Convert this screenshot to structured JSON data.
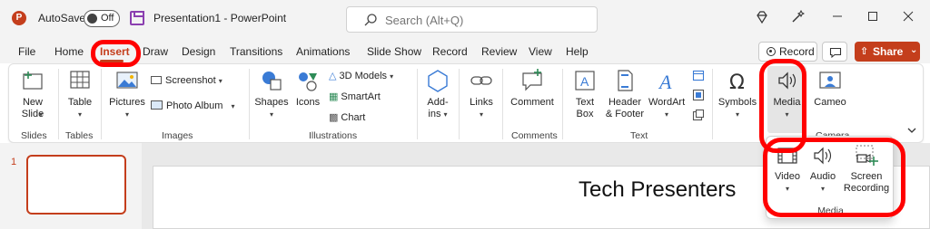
{
  "titlebar": {
    "autosave_label": "AutoSave",
    "autosave_state": "Off",
    "document_title": "Presentation1  -  PowerPoint",
    "search_placeholder": "Search (Alt+Q)",
    "icons": [
      "diamond-icon",
      "wand-icon",
      "minimize-icon",
      "maximize-icon",
      "close-icon"
    ]
  },
  "tabs": [
    {
      "label": "File"
    },
    {
      "label": "Home"
    },
    {
      "label": "Insert",
      "active": true
    },
    {
      "label": "Draw"
    },
    {
      "label": "Design"
    },
    {
      "label": "Transitions"
    },
    {
      "label": "Animations"
    },
    {
      "label": "Slide Show"
    },
    {
      "label": "Record"
    },
    {
      "label": "Review"
    },
    {
      "label": "View"
    },
    {
      "label": "Help"
    }
  ],
  "right_actions": {
    "record": "Record",
    "share": "Share"
  },
  "ribbon": {
    "slides": {
      "new_slide_line1": "New",
      "new_slide_line2": "Slide",
      "group": "Slides"
    },
    "tables": {
      "table": "Table",
      "group": "Tables"
    },
    "images": {
      "pictures": "Pictures",
      "screenshot": "Screenshot",
      "photo_album": "Photo Album",
      "group": "Images"
    },
    "illustrations": {
      "shapes": "Shapes",
      "icons": "Icons",
      "models3d": "3D Models",
      "smartart": "SmartArt",
      "chart": "Chart",
      "group": "Illustrations"
    },
    "addins": {
      "line1": "Add-",
      "line2": "ins"
    },
    "links": {
      "links": "Links"
    },
    "comments": {
      "comment": "Comment",
      "group": "Comments"
    },
    "text": {
      "textbox_line1": "Text",
      "textbox_line2": "Box",
      "header_line1": "Header",
      "header_line2": "& Footer",
      "wordart": "WordArt",
      "group": "Text"
    },
    "symbols": {
      "symbols": "Symbols"
    },
    "media": {
      "media": "Media"
    },
    "camera": {
      "cameo": "Cameo",
      "group": "Camera"
    }
  },
  "slides_pane": {
    "slide_number": "1"
  },
  "slide": {
    "title": "Tech Presenters"
  },
  "media_dropdown": {
    "video": "Video",
    "audio": "Audio",
    "screen_recording_line1": "Screen",
    "screen_recording_line2": "Recording",
    "group": "Media"
  },
  "colors": {
    "accent": "#c43e1c",
    "annotation": "#ff0000",
    "titlebar_bg": "#f3f3f3"
  }
}
